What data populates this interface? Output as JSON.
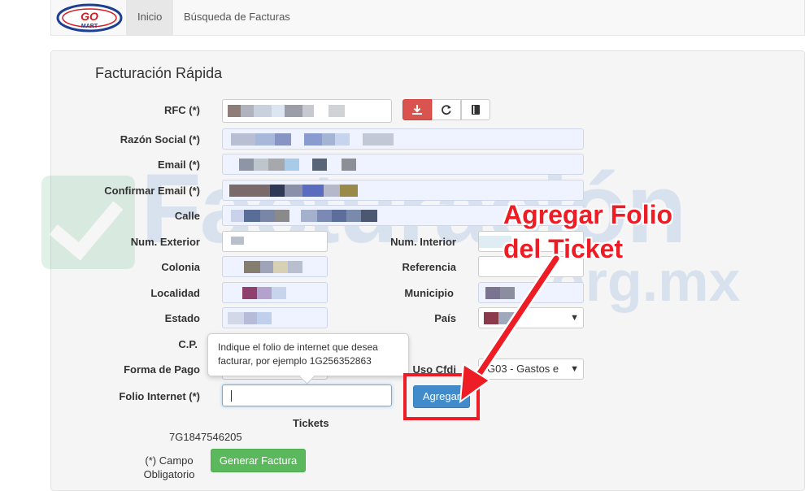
{
  "nav": {
    "logo_text": "GO MART",
    "home": "Inicio",
    "search": "Búsqueda de Facturas"
  },
  "form": {
    "title": "Facturación Rápida",
    "labels": {
      "rfc": "RFC (*)",
      "razon": "Razón Social (*)",
      "email": "Email (*)",
      "confirm": "Confirmar Email (*)",
      "calle": "Calle",
      "num_ext": "Num. Exterior",
      "num_int": "Num. Interior",
      "colonia": "Colonia",
      "referencia": "Referencia",
      "localidad": "Localidad",
      "municipio": "Municipio",
      "estado": "Estado",
      "pais": "País",
      "cp": "C.P.",
      "forma_pago": "Forma de Pago",
      "uso_cfdi": "Uso Cfdi",
      "folio": "Folio Internet (*)"
    },
    "uso_cfdi_value": "G03 - Gastos e",
    "tooltip": "Indique el folio de internet que desea facturar, por ejemplo 1G256352863",
    "add_button": "Agregar",
    "tickets_label": "Tickets",
    "ticket_value": "7G1847546205",
    "required_note": "(*) Campo Obligatorio",
    "generate_button": "Generar Factura"
  },
  "watermark": {
    "text": "Facturación",
    "sub": "org.mx"
  },
  "annotation": {
    "line1": "Agregar Folio",
    "line2": "del Ticket"
  },
  "colors": {
    "accent_red": "#ee1c24",
    "primary_blue": "#428bca",
    "success_green": "#5cb85c",
    "danger_red": "#d9534f"
  }
}
